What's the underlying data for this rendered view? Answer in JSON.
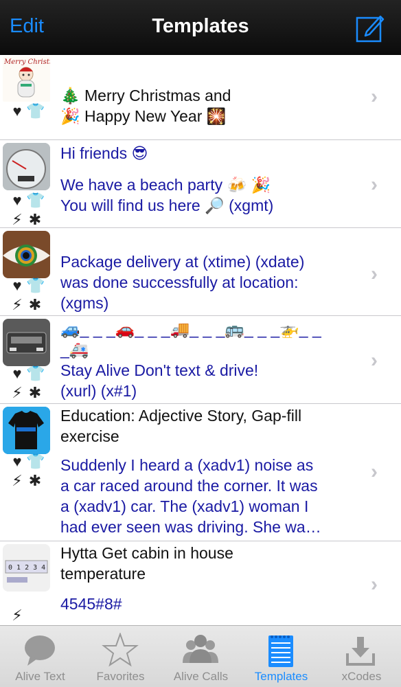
{
  "navbar": {
    "edit_label": "Edit",
    "title": "Templates",
    "compose_icon": "compose-icon"
  },
  "rows": [
    {
      "thumb_caption": "Merry Christmas",
      "name": "",
      "body_line1": "🎄 Merry Christmas and",
      "body_line2": "🎉 Happy New Year 🎇",
      "icons": [
        "heart-icon",
        "shirt-icon"
      ]
    },
    {
      "name": "Hi friends 😎",
      "body_line1": "We have a beach party 🍻 🎉",
      "body_line2": "You will find us here 🔎 (xgmt)",
      "icons": [
        "heart-icon",
        "shirt-icon",
        "bolt-icon",
        "puzzle-icon"
      ]
    },
    {
      "name": "",
      "body_line1": "Package delivery at (xtime) (xdate)",
      "body_line2": "was done successfully at location:",
      "body_line3": "(xgms)",
      "icons": [
        "heart-icon",
        "shirt-icon",
        "bolt-icon",
        "puzzle-icon"
      ]
    },
    {
      "name": "",
      "body_line1": "🚙_ _ _🚗_ _ _🚚_ _ _🚌_ _ _🚁_ _",
      "body_line2": "_🚑",
      "body_line3": "Stay Alive Don't text & drive!",
      "body_line4": "(xurl) (x#1)",
      "icons": [
        "heart-icon",
        "shirt-icon",
        "bolt-icon",
        "puzzle-icon"
      ]
    },
    {
      "name_line1": "Education: Adjective Story, Gap-fill",
      "name_line2": "exercise",
      "body_line1": "Suddenly I heard a (xadv1) noise as",
      "body_line2": "a car raced around the corner. It was",
      "body_line3": "a (xadv1) car. The (xadv1) woman I",
      "body_line4": "had ever seen was driving. She wa…",
      "icons": [
        "heart-icon",
        "shirt-icon",
        "bolt-icon",
        "puzzle-icon"
      ]
    },
    {
      "name_line1": "Hytta Get cabin in house",
      "name_line2": "temperature",
      "body_line1": "4545#8#",
      "icons": [
        "bolt-icon"
      ]
    }
  ],
  "tabs": [
    {
      "label": "Alive Text",
      "icon": "speech-bubble-icon",
      "active": false
    },
    {
      "label": "Favorites",
      "icon": "star-icon",
      "active": false
    },
    {
      "label": "Alive Calls",
      "icon": "people-icon",
      "active": false
    },
    {
      "label": "Templates",
      "icon": "notepad-icon",
      "active": true
    },
    {
      "label": "xCodes",
      "icon": "download-tray-icon",
      "active": false
    }
  ],
  "colors": {
    "accent": "#1a8cff",
    "body_text": "#1a1aa3",
    "navbar_bg": "#161616",
    "tab_inactive": "#8e8e8e"
  }
}
